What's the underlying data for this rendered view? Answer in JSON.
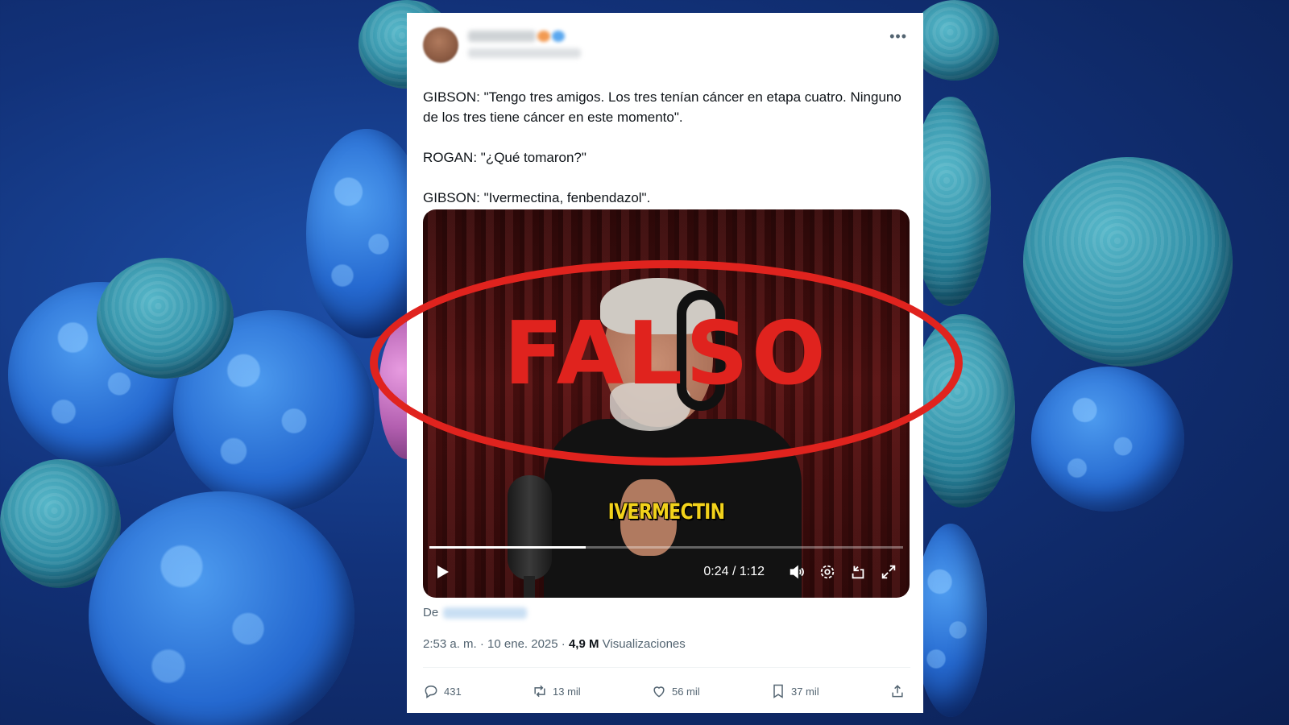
{
  "tweet": {
    "menu_icon": "more-icon",
    "text": "GIBSON: \"Tengo tres amigos. Los tres tenían cáncer en etapa cuatro. Ninguno de los tres tiene cáncer en este momento\".\n\nROGAN: \"¿Qué tomaron?\"\n\nGIBSON: \"Ivermectina, fenbendazol\".",
    "source_label": "De",
    "timestamp": "2:53 a. m. · 10 ene. 2025 · ",
    "views_count": "4,9 M",
    "views_label": " Visualizaciones"
  },
  "video": {
    "caption": "IVERMECTIN",
    "time": "0:24 / 1:12",
    "progress": 0.33,
    "icons": [
      "play-icon",
      "volume-icon",
      "settings-icon",
      "dock-icon",
      "fullscreen-icon"
    ]
  },
  "stamp": {
    "text": "FALSO",
    "color": "#e0231e"
  },
  "actions": {
    "replies": "431",
    "reposts": "13 mil",
    "likes": "56 mil",
    "bookmarks": "37 mil"
  }
}
